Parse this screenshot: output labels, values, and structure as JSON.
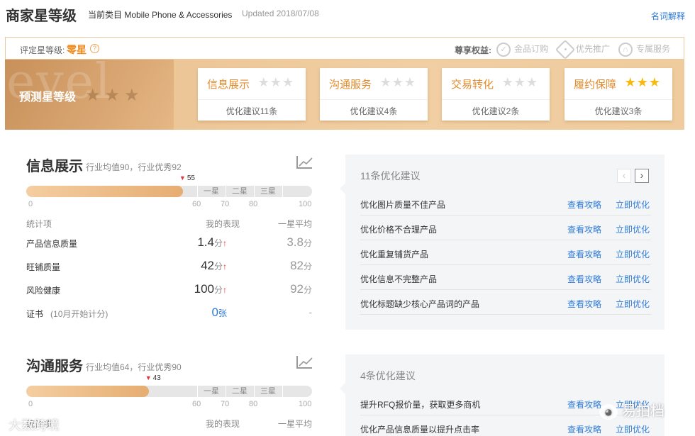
{
  "header": {
    "title": "商家星等级",
    "category": "当前类目 Mobile Phone & Accessories",
    "updated": "Updated 2018/07/08",
    "glossary": "名词解释"
  },
  "rating": {
    "label": "评定星等级:",
    "value": "零星",
    "help": "?",
    "benefits_label": "尊享权益:",
    "benefits": [
      {
        "icon": "check-circle-icon",
        "label": "金品订购"
      },
      {
        "icon": "tag-icon",
        "label": "优先推广"
      },
      {
        "icon": "headset-icon",
        "label": "专属服务"
      }
    ]
  },
  "banner": {
    "watermark": "evel",
    "label": "预测星等级",
    "stars_on": 0,
    "stars_total": 3,
    "cards": [
      {
        "title": "信息展示",
        "stars_on": 0,
        "tip": "优化建议11条"
      },
      {
        "title": "沟通服务",
        "stars_on": 0,
        "tip": "优化建议4条"
      },
      {
        "title": "交易转化",
        "stars_on": 0,
        "tip": "优化建议2条"
      },
      {
        "title": "履约保障",
        "stars_on": 3,
        "tip": "优化建议3条"
      }
    ]
  },
  "levels": [
    "一星",
    "二星",
    "三星"
  ],
  "ticks": [
    "0",
    "60",
    "70",
    "80",
    "100"
  ],
  "stat_headers": {
    "item": "统计项",
    "mine": "我的表现",
    "avg": "一星平均"
  },
  "sections": [
    {
      "title": "信息展示",
      "sub": "行业均值90，行业优秀92",
      "score": 55,
      "score_label": "55",
      "rows": [
        {
          "label": "产品信息质量",
          "mine": "1.4",
          "mine_unit": "分",
          "arrow": "↑",
          "avg": "3.8",
          "avg_unit": "分"
        },
        {
          "label": "旺铺质量",
          "mine": "42",
          "mine_unit": "分",
          "arrow": "↑",
          "avg": "82",
          "avg_unit": "分"
        },
        {
          "label": "风险健康",
          "mine": "100",
          "mine_unit": "分",
          "arrow": "↑",
          "avg": "92",
          "avg_unit": "分"
        }
      ],
      "cert": {
        "label": "证书",
        "note": "(10月开始计分)",
        "mine": "0",
        "mine_unit": "张",
        "avg": "-"
      },
      "suggestions": {
        "title": "11条优化建议",
        "guide_label": "查看攻略",
        "optimize_label": "立即优化",
        "items": [
          "优化图片质量不佳产品",
          "优化价格不合理产品",
          "优化重复铺货产品",
          "优化信息不完整产品",
          "优化标题缺少核心产品词的产品"
        ]
      }
    },
    {
      "title": "沟通服务",
      "sub": "行业均值64，行业优秀90",
      "score": 43,
      "score_label": "43",
      "suggestions": {
        "title": "4条优化建议",
        "guide_label": "查看攻略",
        "optimize_label": "立即优化",
        "items": [
          "提升RFQ报价量，获取更多商机",
          "优化产品信息质量以提升点击率"
        ]
      }
    }
  ],
  "watermarks": {
    "left": "大数跨境",
    "right": "易拍档"
  },
  "colors": {
    "accent": "#f08d1e",
    "link": "#2d7bd8",
    "star_on": "#f5b90f",
    "up_arrow": "#e5333b"
  }
}
